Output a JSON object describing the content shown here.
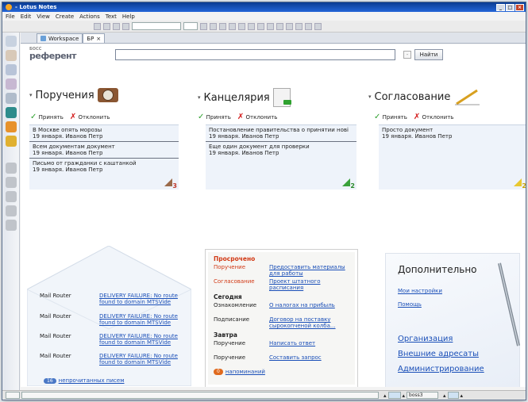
{
  "window": {
    "title": "- Lotus Notes"
  },
  "menu": [
    "File",
    "Edit",
    "View",
    "Create",
    "Actions",
    "Text",
    "Help"
  ],
  "tabs": [
    {
      "label": "Workspace"
    },
    {
      "label": "БР"
    }
  ],
  "logo": {
    "line1": "БОСС",
    "line2": "референт"
  },
  "search": {
    "placeholder": "",
    "button": "Найти",
    "clear": "-"
  },
  "actions": {
    "accept": "Принять",
    "reject": "Отклонить"
  },
  "panels": [
    {
      "title": "Поручения",
      "count": "3",
      "items": [
        {
          "line1": "В Москве опять морозы",
          "line2": "19 января. Иванов Петр"
        },
        {
          "line1": "Всем документам документ",
          "line2": "19 января. Иванов Петр"
        },
        {
          "line1": "Письмо от гражданки с каштанкой",
          "line2": "19 января. Иванов Петр"
        }
      ]
    },
    {
      "title": "Канцелярия",
      "count": "2",
      "items": [
        {
          "line1": "Постановление правительства о принятии нові",
          "line2": "19 января. Иванов Петр"
        },
        {
          "line1": "Еще один документ для проверки",
          "line2": "19 января. Иванов Петр"
        }
      ]
    },
    {
      "title": "Согласование",
      "count": "2",
      "items": [
        {
          "line1": "Просто документ",
          "line2": "19 января. Иванов Петр"
        }
      ]
    }
  ],
  "mail": {
    "rows": [
      {
        "from": "Mail Router",
        "subject": "DELIVERY FAILURE: No route found to domain MTSVide"
      },
      {
        "from": "Mail Router",
        "subject": "DELIVERY FAILURE: No route found to domain MTSVide"
      },
      {
        "from": "Mail Router",
        "subject": "DELIVERY FAILURE: No route found to domain MTSVide"
      },
      {
        "from": "Mail Router",
        "subject": "DELIVERY FAILURE: No route found to domain MTSVide"
      }
    ],
    "unread_count": "16",
    "unread_label": "непрочитанных писем"
  },
  "todo": {
    "overdue_title": "Просрочено",
    "overdue": [
      {
        "type": "Поручение",
        "text": "Предоставить материалы для работы"
      },
      {
        "type": "Согласование",
        "text": "Проект штатного расписания"
      }
    ],
    "today_title": "Сегодня",
    "today": [
      {
        "type": "Ознакомление",
        "text": "О налогах на прибыль"
      },
      {
        "type": "Подписание",
        "text": "Договор на поставку сырокопченой колба..."
      }
    ],
    "tomorrow_title": "Завтра",
    "tomorrow": [
      {
        "type": "Поручение",
        "text": "Написать ответ"
      },
      {
        "type": "Поручение",
        "text": "Составить запрос"
      }
    ],
    "reminders_count": "0",
    "reminders_label": "напоминаний"
  },
  "extra": {
    "title": "Дополнительно",
    "links_small": [
      "Мои настройки",
      "Помощь"
    ],
    "links_big": [
      "Организация",
      "Внешние адресаты",
      "Администрирование"
    ]
  },
  "status": {
    "server": "boss3"
  }
}
